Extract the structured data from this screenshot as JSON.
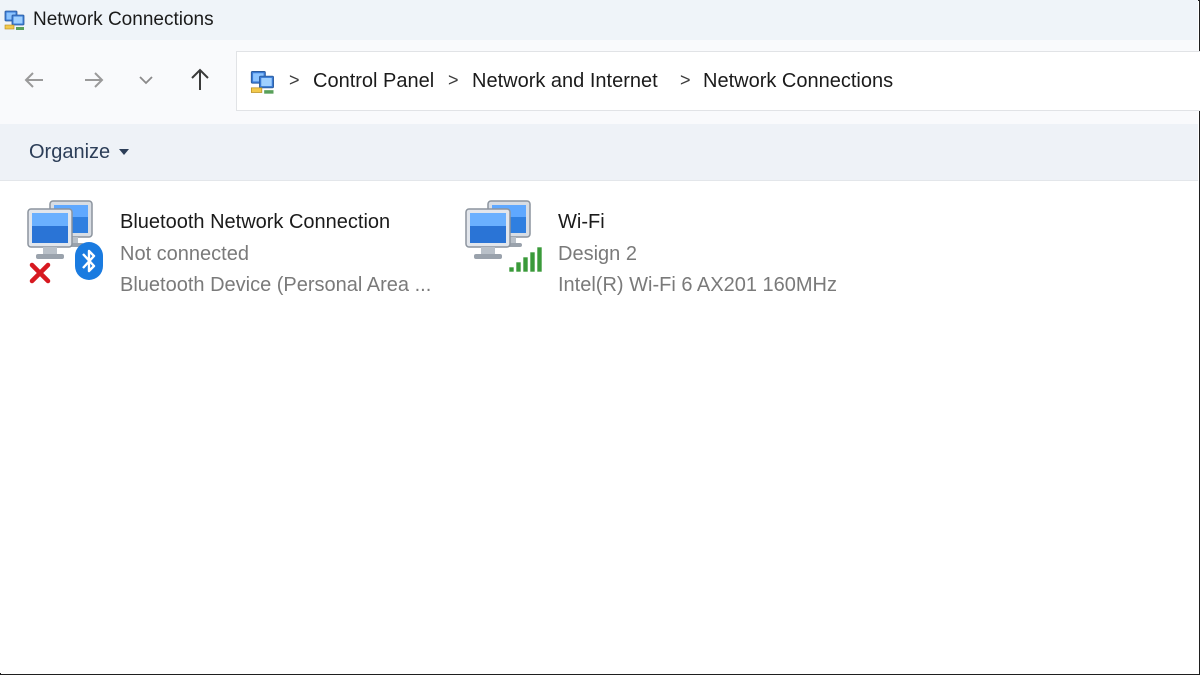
{
  "window": {
    "title": "Network Connections",
    "icon": "network-connections-icon"
  },
  "nav": {
    "back_icon": "arrow-left-icon",
    "forward_icon": "arrow-right-icon",
    "recent_icon": "chevron-down-icon",
    "up_icon": "arrow-up-icon"
  },
  "breadcrumb": {
    "icon": "network-connections-icon",
    "separator": ">",
    "items": [
      "Control Panel",
      "Network and Internet",
      "Network Connections"
    ]
  },
  "toolbar": {
    "organize_label": "Organize",
    "organize_icon": "caret-down-icon"
  },
  "connections": [
    {
      "name": "Bluetooth Network Connection",
      "status": "Not connected",
      "device": "Bluetooth Device (Personal Area ...",
      "icon": "network-computers-icon",
      "badges": [
        "red-x-icon",
        "bluetooth-icon"
      ]
    },
    {
      "name": "Wi-Fi",
      "status": "Design 2",
      "device": "Intel(R) Wi-Fi 6 AX201 160MHz",
      "icon": "network-computers-icon",
      "badges": [
        "wifi-signal-bars-icon"
      ]
    }
  ],
  "colors": {
    "title_bar": "#eff4f9",
    "command_bar": "#eef2f7",
    "secondary_text": "#7a7a7a",
    "bluetooth_blue": "#1a7be0",
    "error_red": "#d71920",
    "signal_green": "#3a9a3a"
  }
}
